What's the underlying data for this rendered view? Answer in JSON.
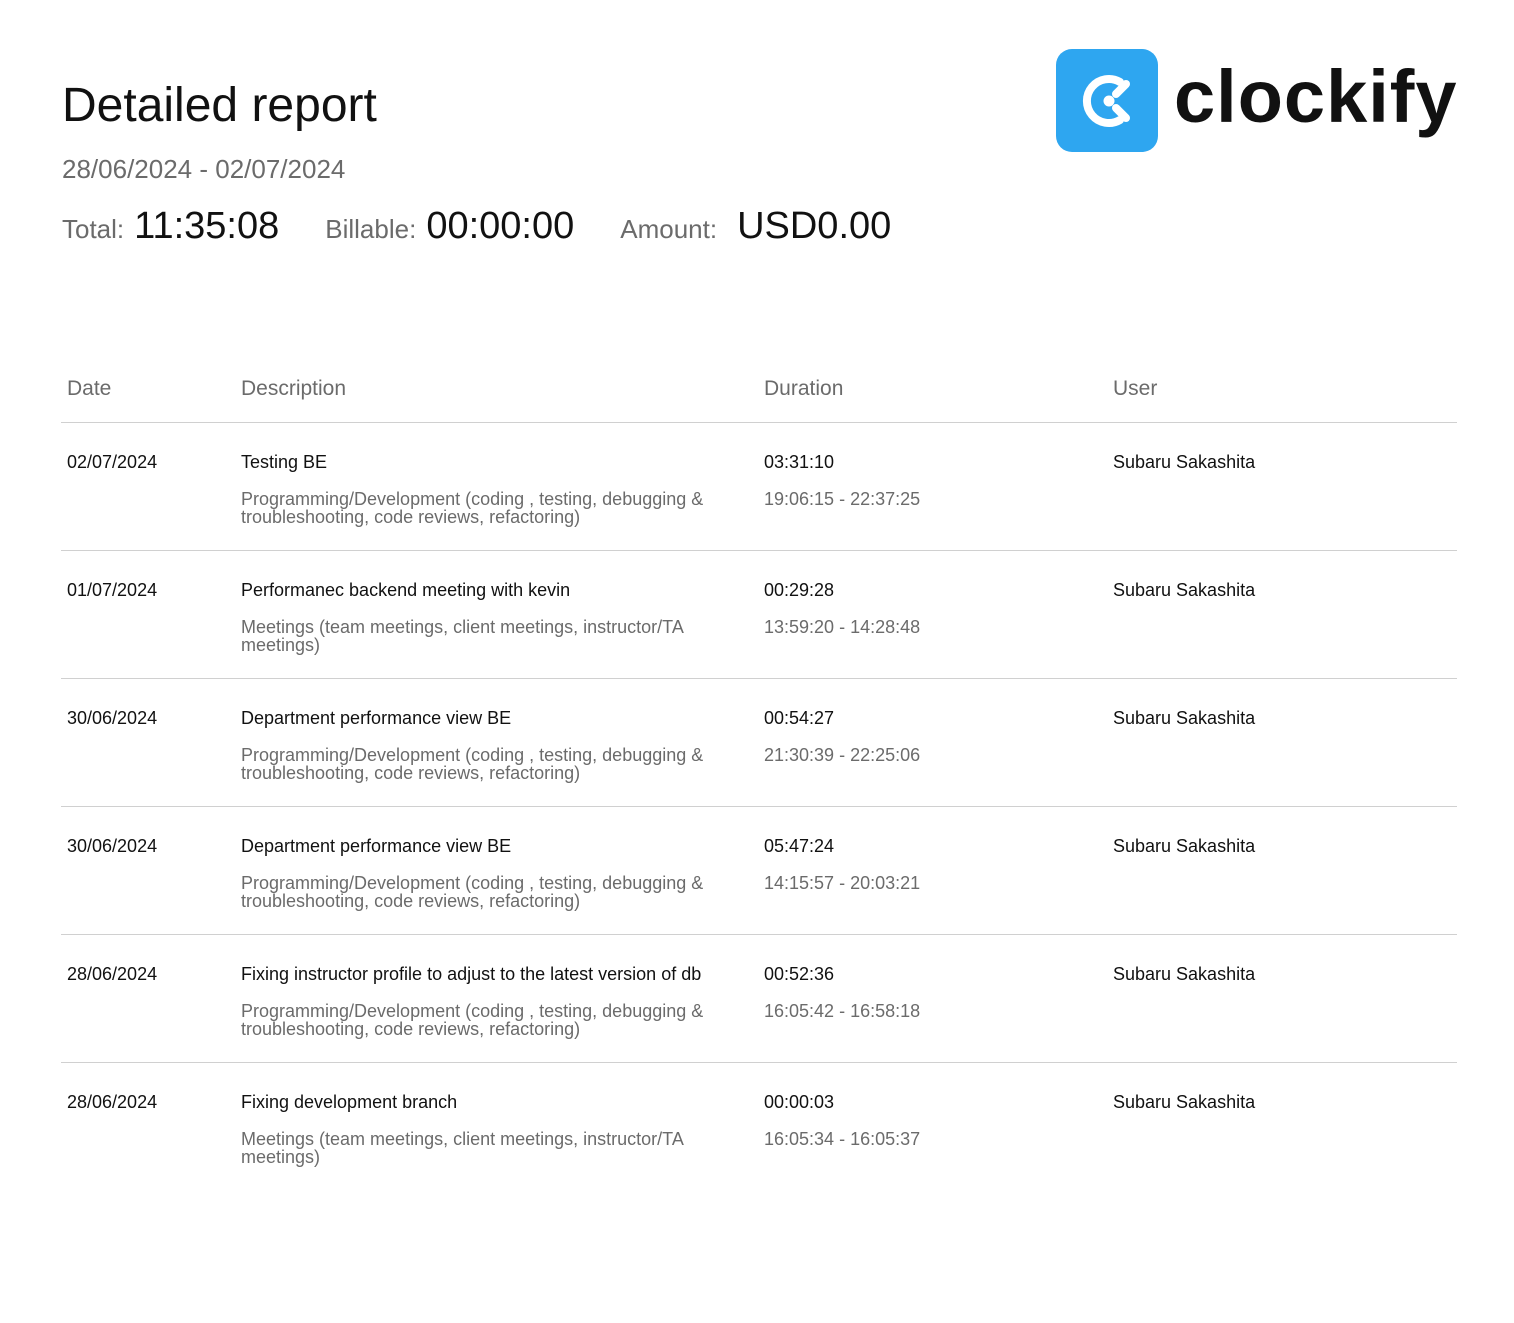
{
  "header": {
    "title": "Detailed report",
    "date_range": "28/06/2024 - 02/07/2024"
  },
  "summary": {
    "total_label": "Total:",
    "total_value": "11:35:08",
    "billable_label": "Billable:",
    "billable_value": "00:00:00",
    "amount_label": "Amount:",
    "amount_value": "USD0.00"
  },
  "brand": {
    "name": "clockify",
    "logo_icon": "clockify-logo-icon",
    "accent_color": "#2ea6f0"
  },
  "table": {
    "columns": [
      "Date",
      "Description",
      "Duration",
      "User"
    ],
    "rows": [
      {
        "date": "02/07/2024",
        "description": "Testing BE",
        "category": "Programming/Development (coding , testing, debugging & troubleshooting, code reviews, refactoring)",
        "duration": "03:31:10",
        "time_range": "19:06:15 - 22:37:25",
        "user": "Subaru Sakashita"
      },
      {
        "date": "01/07/2024",
        "description": "Performanec backend meeting with kevin",
        "category": "Meetings (team meetings, client meetings, instructor/TA meetings)",
        "duration": "00:29:28",
        "time_range": "13:59:20 - 14:28:48",
        "user": "Subaru Sakashita"
      },
      {
        "date": "30/06/2024",
        "description": "Department performance view BE",
        "category": "Programming/Development (coding , testing, debugging & troubleshooting, code reviews, refactoring)",
        "duration": "00:54:27",
        "time_range": "21:30:39 - 22:25:06",
        "user": "Subaru Sakashita"
      },
      {
        "date": "30/06/2024",
        "description": "Department performance view BE",
        "category": "Programming/Development (coding , testing, debugging & troubleshooting, code reviews, refactoring)",
        "duration": "05:47:24",
        "time_range": "14:15:57 - 20:03:21",
        "user": "Subaru Sakashita"
      },
      {
        "date": "28/06/2024",
        "description": "Fixing instructor profile to adjust to the latest version of db",
        "category": "Programming/Development (coding , testing, debugging & troubleshooting, code reviews, refactoring)",
        "duration": "00:52:36",
        "time_range": "16:05:42 - 16:58:18",
        "user": "Subaru Sakashita"
      },
      {
        "date": "28/06/2024",
        "description": "Fixing development branch",
        "category": "Meetings (team meetings, client meetings, instructor/TA meetings)",
        "duration": "00:00:03",
        "time_range": "16:05:34 - 16:05:37",
        "user": "Subaru Sakashita"
      }
    ]
  }
}
